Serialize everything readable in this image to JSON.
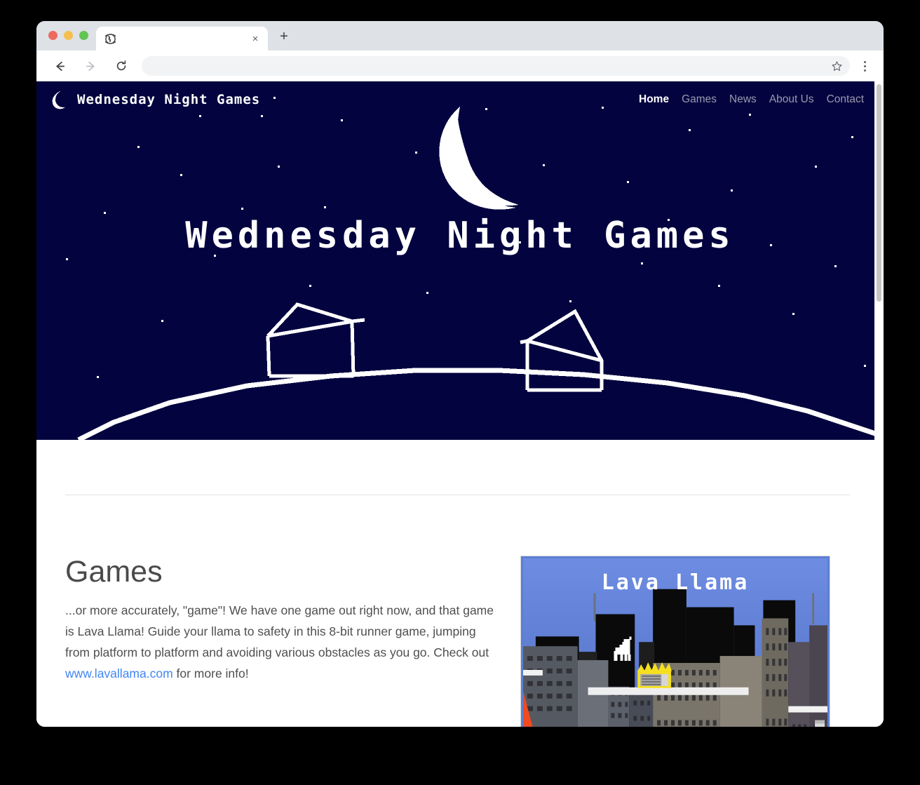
{
  "browser": {
    "tab": {
      "title": "",
      "favicon_icon": "globe-icon",
      "close_icon": "×"
    },
    "new_tab_label": "+",
    "toolbar": {
      "back_icon": "arrow-left-icon",
      "forward_icon": "arrow-right-icon",
      "reload_icon": "reload-icon",
      "url": "",
      "url_placeholder": "",
      "bookmark_icon": "star-icon",
      "menu_icon": "three-dot-menu-icon"
    },
    "traffic_lights": {
      "close": "#ed6a5e",
      "minimize": "#f5bf4f",
      "maximize": "#61c554"
    }
  },
  "site": {
    "brand": {
      "logo_icon": "crescent-moon-icon",
      "name": "Wednesday Night Games"
    },
    "nav": [
      {
        "label": "Home",
        "active": true
      },
      {
        "label": "Games",
        "active": false
      },
      {
        "label": "News",
        "active": false
      },
      {
        "label": "About Us",
        "active": false
      },
      {
        "label": "Contact",
        "active": false
      }
    ],
    "hero": {
      "title": "Wednesday Night Games",
      "background_color": "#03033f",
      "moon_icon": "crescent-moon-icon",
      "art_description": "pixel-art night sky with stars, crescent moon, and two barns on a hill horizon"
    },
    "games_section": {
      "heading": "Games",
      "body_before_link": "...or more accurately, \"game\"! We have one game out right now, and that game is Lava Llama! Guide your llama to safety in this 8-bit runner game, jumping from platform to platform and avoiding various obstacles as you go. Check out ",
      "link_text": "www.lavallama.com",
      "link_color": "#4285f4",
      "body_after_link": " for more info!"
    },
    "game_card": {
      "game_title": "Lava Llama",
      "sky_color": "#5b7fd4",
      "lava_color": "#f04a1e",
      "llama_icon": "llama-sprite-icon",
      "obstacle_icon": "burning-air-conditioner-icon"
    }
  },
  "scrollbar": {
    "thumb_color": "#c6c6c6"
  }
}
